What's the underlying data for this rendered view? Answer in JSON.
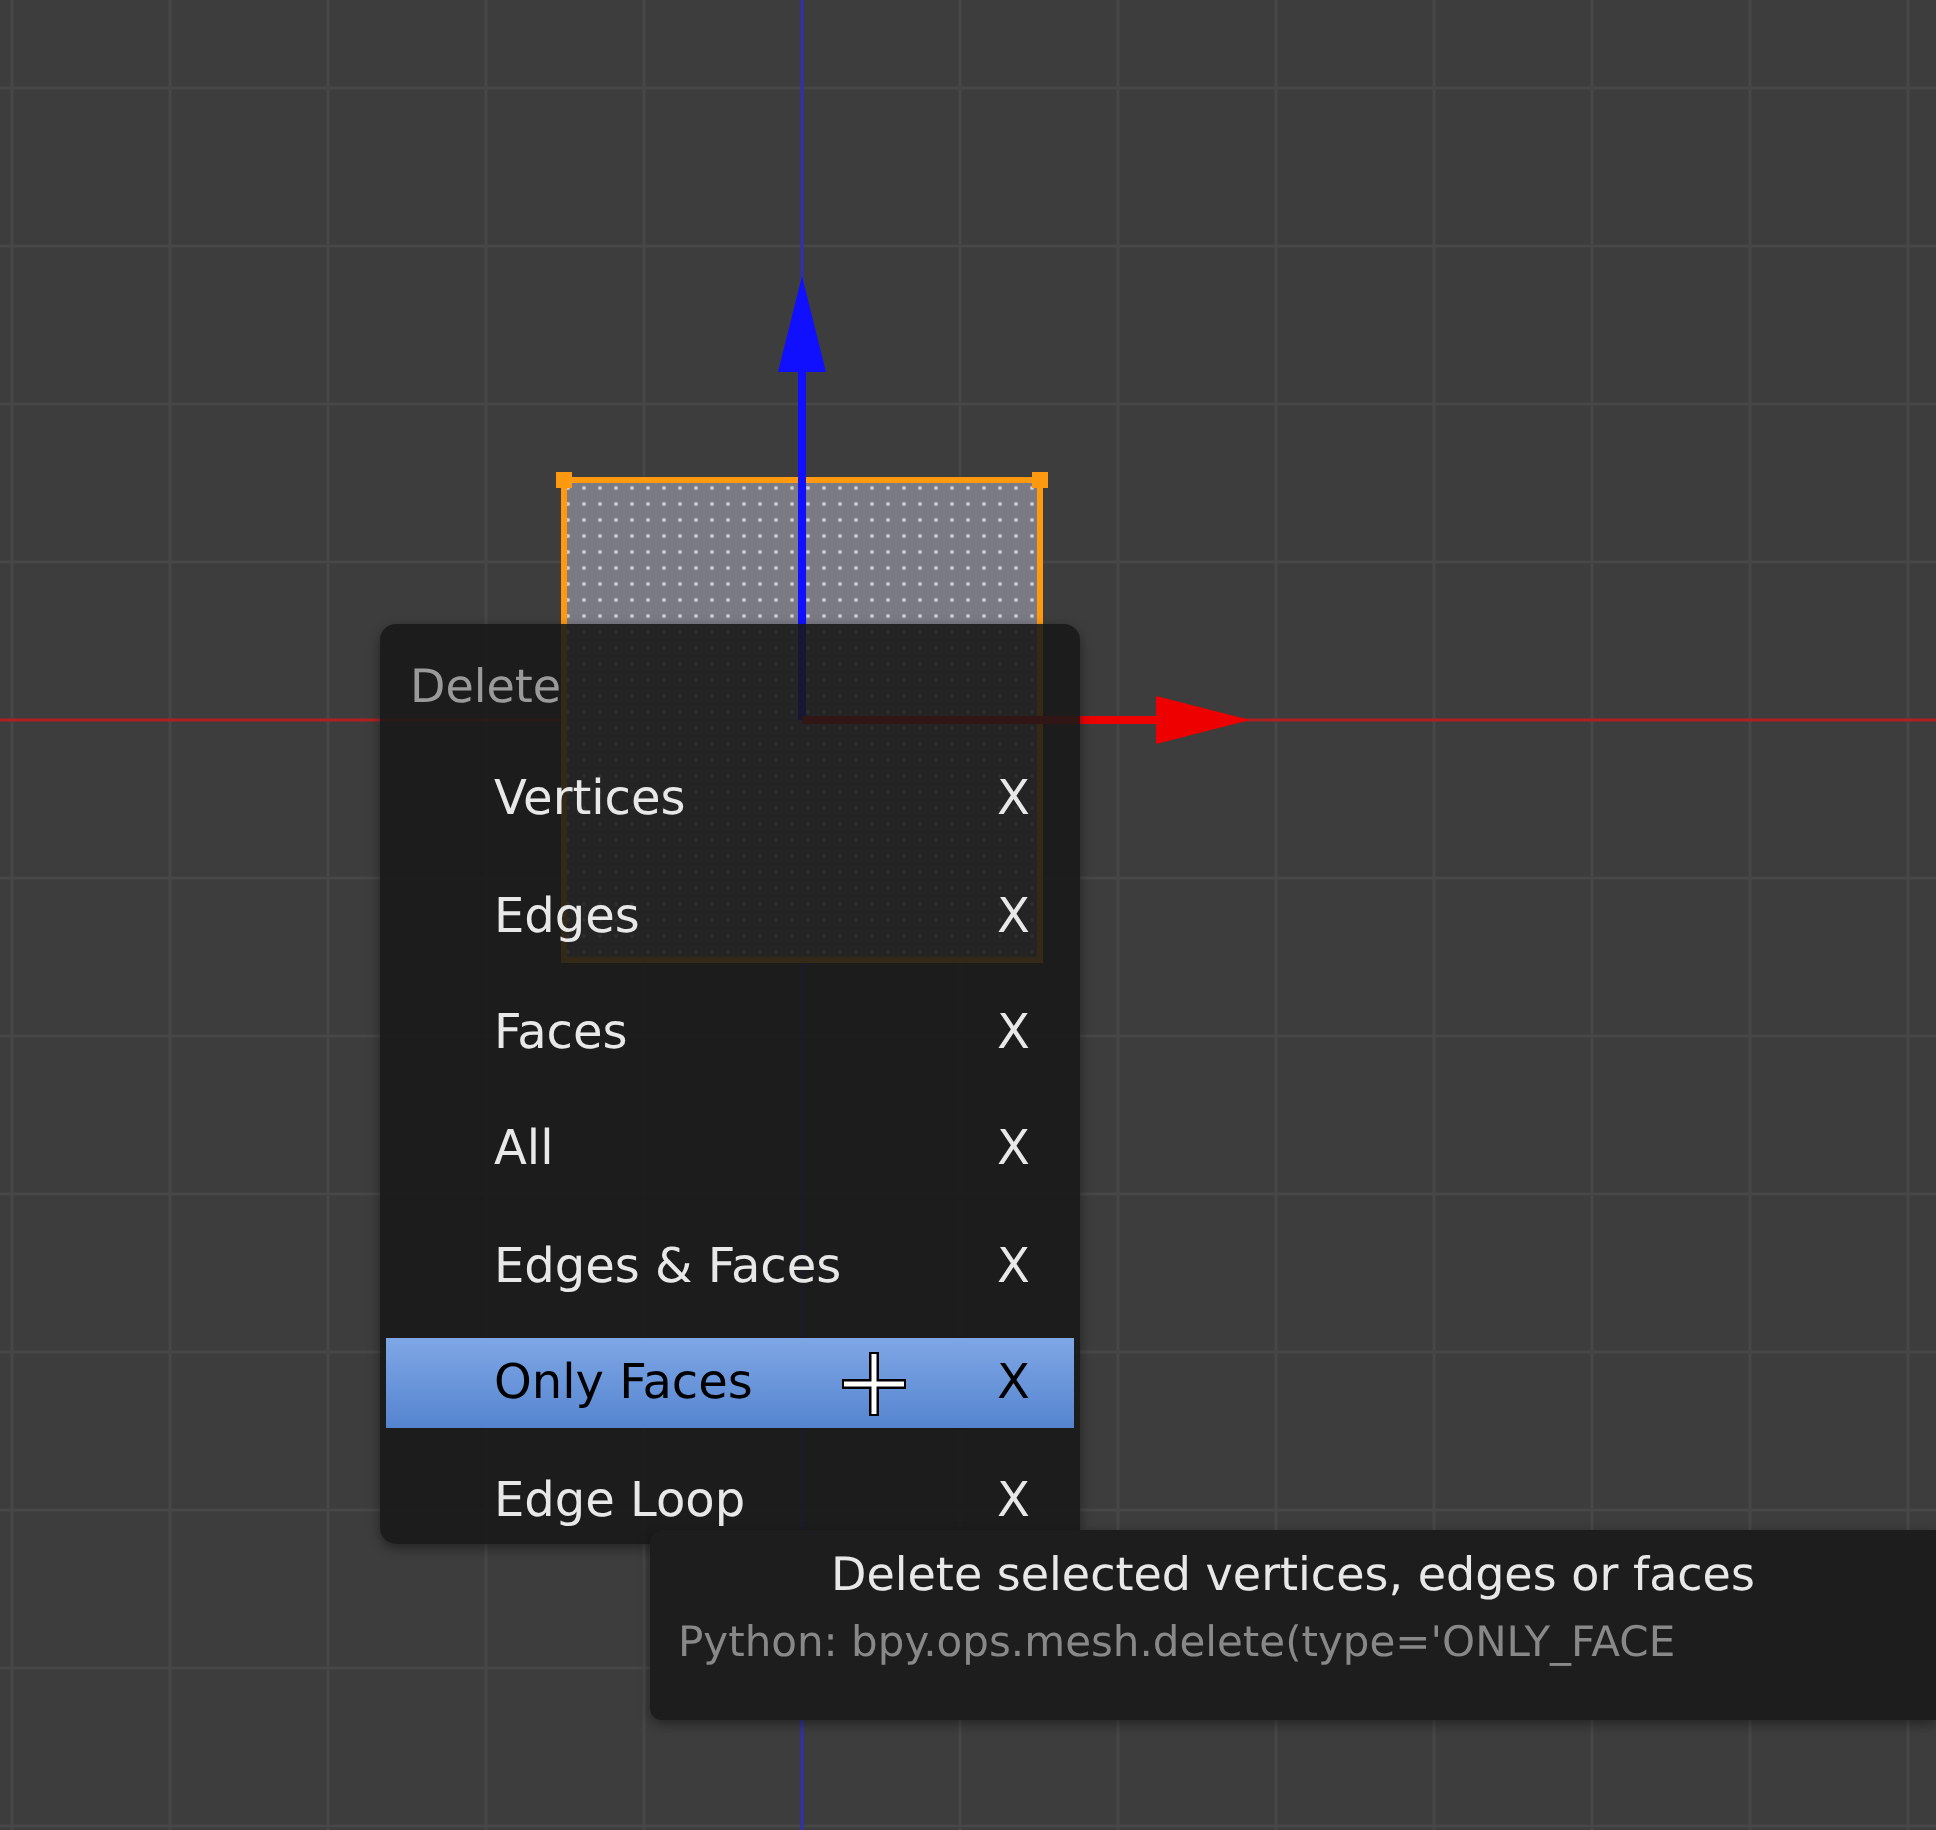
{
  "menu": {
    "title": "Delete",
    "items": [
      {
        "label": "Vertices",
        "shortcut": "X",
        "selected": false
      },
      {
        "label": "Edges",
        "shortcut": "X",
        "selected": false
      },
      {
        "label": "Faces",
        "shortcut": "X",
        "selected": false
      },
      {
        "label": "All",
        "shortcut": "X",
        "selected": false
      },
      {
        "label": "Edges & Faces",
        "shortcut": "X",
        "selected": false
      },
      {
        "label": "Only Faces",
        "shortcut": "X",
        "selected": true
      },
      {
        "label": "Edge Loop",
        "shortcut": "X",
        "selected": false
      }
    ]
  },
  "tooltip": {
    "description": "Delete selected vertices, edges or faces",
    "python": "Python: bpy.ops.mesh.delete(type='ONLY_FACE"
  }
}
